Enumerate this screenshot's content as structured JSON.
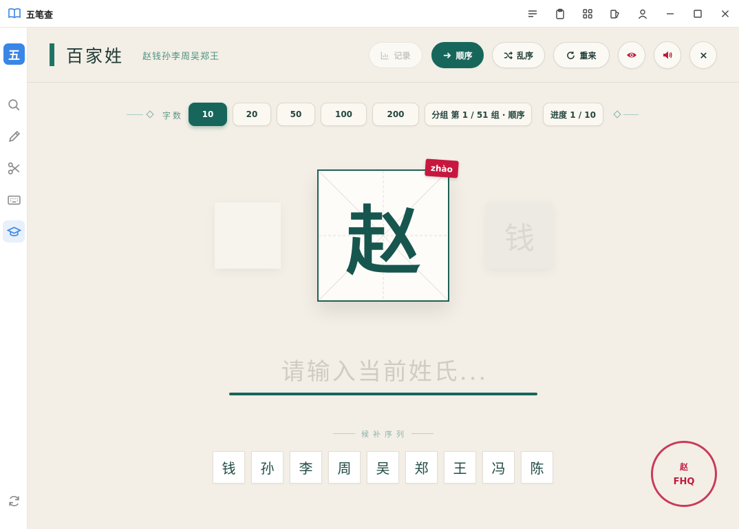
{
  "window": {
    "title": "五笔查"
  },
  "sidebar": {
    "logo": "五"
  },
  "header": {
    "title": "百家姓",
    "subtitle": "赵钱孙李周吴郑王",
    "buttons": {
      "record": "记录",
      "sequential": "顺序",
      "shuffle": "乱序",
      "restart": "重来"
    }
  },
  "controls": {
    "count_label": "字数",
    "counts": [
      "10",
      "20",
      "50",
      "100",
      "200"
    ],
    "active_count": "10",
    "group_info": "分组 第 1 / 51 组 · 顺序",
    "progress": "进度 1 / 10"
  },
  "card": {
    "current_char": "赵",
    "pinyin": "zhào",
    "next_char": "钱"
  },
  "input": {
    "placeholder": "请输入当前姓氏..."
  },
  "sequence": {
    "label": "候补序列",
    "chars": [
      "钱",
      "孙",
      "李",
      "周",
      "吴",
      "郑",
      "王",
      "冯",
      "陈"
    ]
  },
  "stamp": {
    "char": "赵",
    "code": "FHQ"
  },
  "colors": {
    "primary": "#17665b",
    "accent_red": "#c0193f",
    "background": "#f3efe6",
    "sidebar_active": "#3a86e6"
  }
}
